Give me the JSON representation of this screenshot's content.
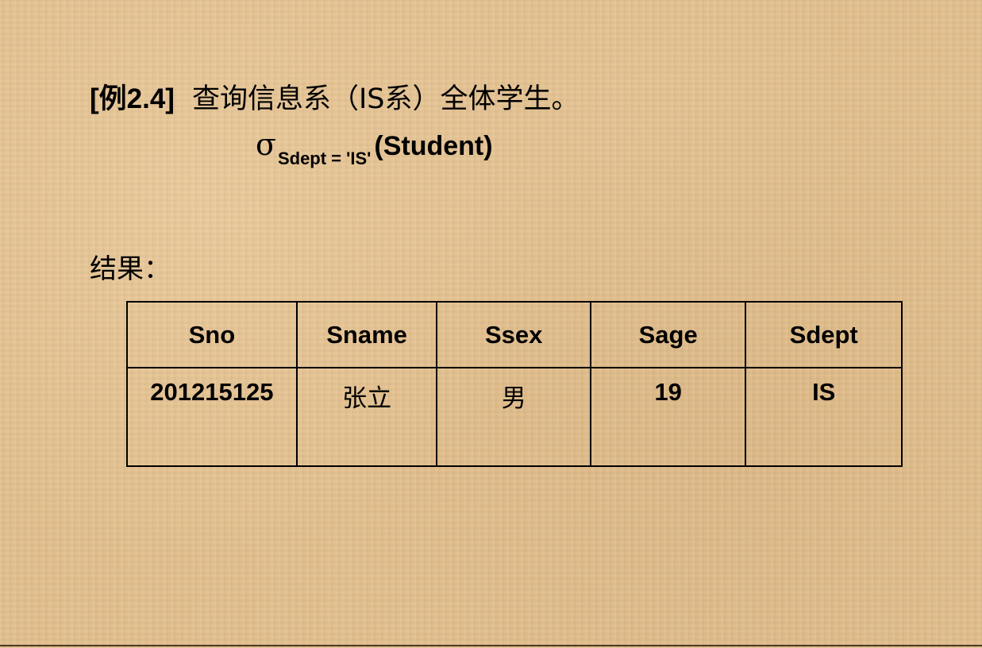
{
  "example": {
    "label": "[例2.4]",
    "text": "查询信息系（IS系）全体学生。"
  },
  "formula": {
    "sigma": "σ",
    "subscript": "Sdept = 'IS'",
    "relation": "(Student)"
  },
  "result_label": "结果：",
  "table": {
    "headers": [
      "Sno",
      "Sname",
      "Ssex",
      "Sage",
      "Sdept"
    ],
    "rows": [
      [
        "201215125",
        "张立",
        "男",
        "19",
        "IS"
      ]
    ]
  }
}
